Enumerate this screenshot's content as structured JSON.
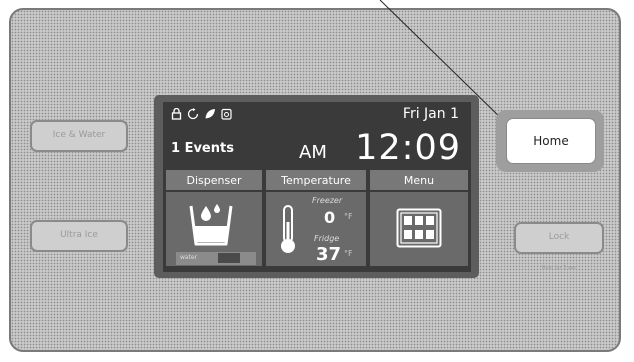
{
  "side_buttons": {
    "top_left": "Ice & Water",
    "bottom_left": "Ultra Ice",
    "home": "Home",
    "lock": "Lock",
    "lock_caption": "Hold for 3 sec"
  },
  "screen": {
    "status_icons": [
      "lock-icon",
      "refresh-icon",
      "leaf-icon",
      "filter-icon"
    ],
    "date": "Fri Jan 1",
    "events": "1 Events",
    "ampm": "AM",
    "time": "12:09",
    "tabs": [
      "Dispenser",
      "Temperature",
      "Menu"
    ],
    "dispenser": {
      "water_label": "water"
    },
    "temperature": {
      "freezer_label": "Freezer",
      "freezer_value": "0",
      "fridge_label": "Fridge",
      "fridge_value": "37",
      "unit": "°F"
    }
  },
  "colors": {
    "panel": "#c9c9c9",
    "screen": "#3a3a3a",
    "home_button": "#ffffff"
  }
}
